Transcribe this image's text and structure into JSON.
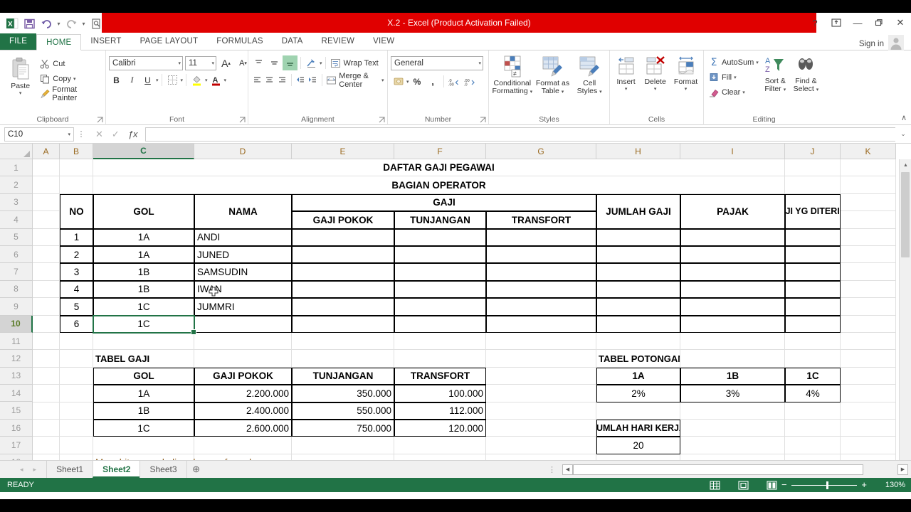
{
  "window": {
    "title": "X.2 -  Excel (Product Activation Failed)",
    "help": "?",
    "ribbon_display": "❐",
    "minimize": "—",
    "restore": "❐",
    "close": "✕",
    "sign_in": "Sign in"
  },
  "quick_access": [
    "save-icon",
    "undo-icon",
    "redo-icon",
    "print-preview-icon",
    "customize-qat-icon"
  ],
  "tabs": [
    {
      "label": "FILE",
      "kind": "file"
    },
    {
      "label": "HOME",
      "kind": "active"
    },
    {
      "label": "INSERT",
      "kind": "normal"
    },
    {
      "label": "PAGE LAYOUT",
      "kind": "normal"
    },
    {
      "label": "FORMULAS",
      "kind": "normal"
    },
    {
      "label": "DATA",
      "kind": "normal"
    },
    {
      "label": "REVIEW",
      "kind": "normal"
    },
    {
      "label": "VIEW",
      "kind": "normal"
    }
  ],
  "ribbon": {
    "clipboard": {
      "label": "Clipboard",
      "paste": "Paste",
      "cut": "Cut",
      "copy": "Copy",
      "format_painter": "Format Painter"
    },
    "font": {
      "label": "Font",
      "family": "Calibri",
      "size": "11",
      "grow": "A",
      "shrink": "A",
      "bold": "B",
      "italic": "I",
      "underline": "U"
    },
    "alignment": {
      "label": "Alignment",
      "wrap_text": "Wrap Text",
      "merge_center": "Merge & Center"
    },
    "number": {
      "label": "Number",
      "format": "General",
      "percent": "%",
      "comma": ",",
      "increase_decimal": ".00",
      "decrease_decimal": ".0"
    },
    "styles": {
      "label": "Styles",
      "conditional_formatting": "Conditional\nFormatting",
      "conditional_formatting_l1": "Conditional",
      "conditional_formatting_l2": "Formatting",
      "format_as_table_l1": "Format as",
      "format_as_table_l2": "Table",
      "cell_styles_l1": "Cell",
      "cell_styles_l2": "Styles"
    },
    "cells": {
      "label": "Cells",
      "insert": "Insert",
      "delete": "Delete",
      "format": "Format"
    },
    "editing": {
      "label": "Editing",
      "autosum": "AutoSum",
      "fill": "Fill",
      "clear": "Clear",
      "sort_filter_l1": "Sort &",
      "sort_filter_l2": "Filter",
      "find_select_l1": "Find &",
      "find_select_l2": "Select"
    },
    "collapse": "∧"
  },
  "formula_bar": {
    "name_box": "C10",
    "cancel": "✕",
    "enter": "✓",
    "fx": "ƒx",
    "value": "",
    "expand": "⌄"
  },
  "grid": {
    "columns": [
      "A",
      "B",
      "C",
      "D",
      "E",
      "F",
      "G",
      "H",
      "I",
      "J",
      "K"
    ],
    "selected_column": "C",
    "rows": [
      "1",
      "2",
      "3",
      "4",
      "5",
      "6",
      "7",
      "8",
      "9",
      "10",
      "11",
      "12",
      "13",
      "14",
      "15",
      "16",
      "17",
      "18"
    ],
    "selected_row": "10",
    "cells": [
      {
        "ref": "C1",
        "text": "DAFTAR GAJI PEGAWAI",
        "align": "center",
        "bold": true,
        "span": [
          2,
          7
        ],
        "merged": true
      },
      {
        "ref": "C2",
        "text": "BAGIAN OPERATOR",
        "align": "center",
        "bold": true,
        "span": [
          2,
          7
        ],
        "merged": true
      },
      {
        "ref": "B3",
        "text": "NO",
        "align": "center",
        "bold": true
      },
      {
        "ref": "C3",
        "text": "GOL",
        "align": "center",
        "bold": true
      },
      {
        "ref": "D3",
        "text": "NAMA",
        "align": "center",
        "bold": true
      },
      {
        "ref": "E3",
        "text": "GAJI",
        "align": "center",
        "bold": true
      },
      {
        "ref": "G3",
        "text": "JUMLAH GAJI",
        "align": "center",
        "bold": true
      },
      {
        "ref": "H3",
        "text": "PAJAK",
        "align": "center",
        "bold": true
      },
      {
        "ref": "I3",
        "text": "GAJI YG DITERIMA",
        "align": "center",
        "bold": true
      },
      {
        "ref": "D4",
        "text": "GAJI POKOK",
        "align": "center",
        "bold": true
      },
      {
        "ref": "E4",
        "text": "TUNJANGAN",
        "align": "center",
        "bold": true
      },
      {
        "ref": "F4",
        "text": "TRANSFORT",
        "align": "center",
        "bold": true
      }
    ],
    "employee_table": {
      "title": "DAFTAR GAJI PEGAWAI",
      "subtitle": "BAGIAN OPERATOR",
      "group_header": "GAJI",
      "headers": [
        "NO",
        "GOL",
        "NAMA",
        "GAJI POKOK",
        "TUNJANGAN",
        "TRANSFORT",
        "JUMLAH GAJI",
        "PAJAK",
        "GAJI YG DITERIMA"
      ],
      "rows": [
        {
          "row": "5",
          "no": "1",
          "gol": "1A",
          "nama": "ANDI",
          "gaji_pokok": "",
          "tunjangan": "",
          "transfort": "",
          "jumlah_gaji": "",
          "pajak": "",
          "gaji_diterima": ""
        },
        {
          "row": "6",
          "no": "2",
          "gol": "1A",
          "nama": "JUNED",
          "gaji_pokok": "",
          "tunjangan": "",
          "transfort": "",
          "jumlah_gaji": "",
          "pajak": "",
          "gaji_diterima": ""
        },
        {
          "row": "7",
          "no": "3",
          "gol": "1B",
          "nama": "SAMSUDIN",
          "gaji_pokok": "",
          "tunjangan": "",
          "transfort": "",
          "jumlah_gaji": "",
          "pajak": "",
          "gaji_diterima": ""
        },
        {
          "row": "8",
          "no": "4",
          "gol": "1B",
          "nama": "IWAN",
          "gaji_pokok": "",
          "tunjangan": "",
          "transfort": "",
          "jumlah_gaji": "",
          "pajak": "",
          "gaji_diterima": ""
        },
        {
          "row": "9",
          "no": "5",
          "gol": "1C",
          "nama": "JUMMRI",
          "gaji_pokok": "",
          "tunjangan": "",
          "transfort": "",
          "jumlah_gaji": "",
          "pajak": "",
          "gaji_diterima": ""
        },
        {
          "row": "10",
          "no": "6",
          "gol": "1C",
          "nama": "",
          "gaji_pokok": "",
          "tunjangan": "",
          "transfort": "",
          "jumlah_gaji": "",
          "pajak": "",
          "gaji_diterima": ""
        }
      ]
    },
    "salary_table": {
      "title": "TABEL GAJI",
      "headers": [
        "GOL",
        "GAJI POKOK",
        "TUNJANGAN",
        "TRANSFORT"
      ],
      "rows": [
        {
          "gol": "1A",
          "gaji_pokok": "2.200.000",
          "tunjangan": "350.000",
          "transfort": "100.000"
        },
        {
          "gol": "1B",
          "gaji_pokok": "2.400.000",
          "tunjangan": "550.000",
          "transfort": "112.000"
        },
        {
          "gol": "1C",
          "gaji_pokok": "2.600.000",
          "tunjangan": "750.000",
          "transfort": "120.000"
        }
      ]
    },
    "tax_table": {
      "title": "TABEL POTONGAN PAJAK",
      "headers": [
        "1A",
        "1B",
        "1C"
      ],
      "values": [
        "2%",
        "3%",
        "4%"
      ]
    },
    "workdays": {
      "label": "JUMLAH HARI KERJA",
      "value": "20"
    },
    "note": "Menghitung perkalian dengan formula"
  },
  "sheet_tabs": {
    "prev": "◂",
    "next": "▸",
    "sheets": [
      "Sheet1",
      "Sheet2",
      "Sheet3"
    ],
    "active": "Sheet2",
    "add": "⊕"
  },
  "status_bar": {
    "state": "READY",
    "view_normal": "normal-view-icon",
    "view_page_layout": "page-layout-view-icon",
    "view_page_break": "page-break-view-icon",
    "zoom_out": "−",
    "zoom_in": "+",
    "zoom": "130%"
  },
  "colors": {
    "accent_green": "#217346",
    "title_red": "#e00000",
    "note_text": "#8a5a1a"
  }
}
